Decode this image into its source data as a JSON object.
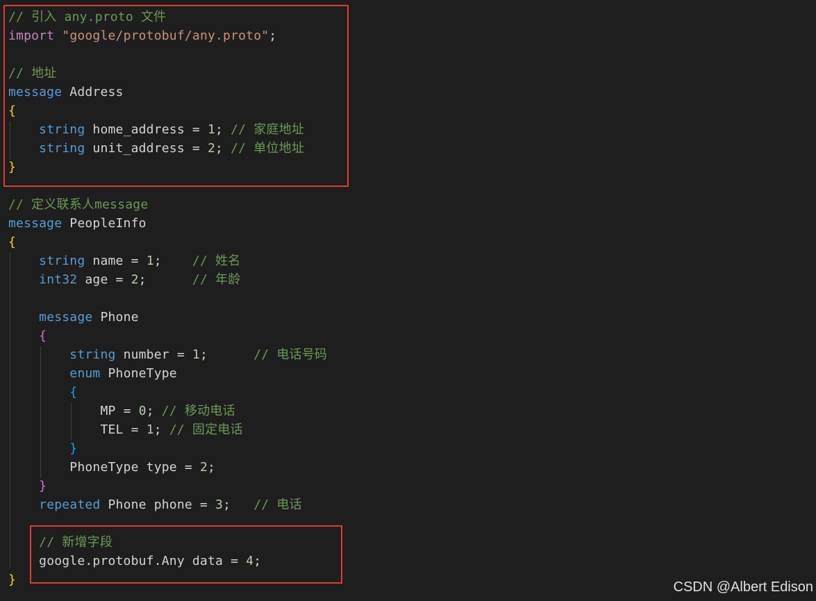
{
  "colors": {
    "background": "#1e1e1e",
    "comment": "#6a9955",
    "keyword": "#569cd6",
    "import_keyword": "#c586c0",
    "string": "#ce9178",
    "number": "#b5cea8",
    "identifier": "#d4d4d4",
    "brace_level1": "#ffd700",
    "brace_level2": "#da70d6",
    "brace_level3": "#179fff",
    "highlight_box": "#e53935"
  },
  "code": {
    "l1": {
      "comment": "// 引入 any.proto 文件"
    },
    "l2": {
      "kw": "import",
      "sp": " ",
      "str": "\"google/protobuf/any.proto\"",
      "punct": ";"
    },
    "l4": {
      "comment": "// 地址"
    },
    "l5": {
      "kw": "message",
      "name": " Address"
    },
    "l6": {
      "brace": "{"
    },
    "l7": {
      "indent": "    ",
      "type": "string",
      "field": " home_address = ",
      "num": "1",
      "semi": "; ",
      "comment": "// 家庭地址"
    },
    "l8": {
      "indent": "    ",
      "type": "string",
      "field": " unit_address = ",
      "num": "2",
      "semi": "; ",
      "comment": "// 单位地址"
    },
    "l9": {
      "brace": "}"
    },
    "l11": {
      "comment": "// 定义联系人message"
    },
    "l12": {
      "kw": "message",
      "name": " PeopleInfo"
    },
    "l13": {
      "brace": "{"
    },
    "l14": {
      "indent": "    ",
      "type": "string",
      "field": " name = ",
      "num": "1",
      "semi": ";    ",
      "comment": "// 姓名"
    },
    "l15": {
      "indent": "    ",
      "type": "int32",
      "field": " age = ",
      "num": "2",
      "semi": ";      ",
      "comment": "// 年龄"
    },
    "l17": {
      "indent": "    ",
      "kw": "message",
      "name": " Phone"
    },
    "l18": {
      "indent": "    ",
      "brace": "{"
    },
    "l19": {
      "indent": "        ",
      "type": "string",
      "field": " number = ",
      "num": "1",
      "semi": ";      ",
      "comment": "// 电话号码"
    },
    "l20": {
      "indent": "        ",
      "kw": "enum",
      "name": " PhoneType"
    },
    "l21": {
      "indent": "        ",
      "brace": "{"
    },
    "l22": {
      "indent": "            ",
      "field": "MP = ",
      "num": "0",
      "semi": "; ",
      "comment": "// 移动电话"
    },
    "l23": {
      "indent": "            ",
      "field": "TEL = ",
      "num": "1",
      "semi": "; ",
      "comment": "// 固定电话"
    },
    "l24": {
      "indent": "        ",
      "brace": "}"
    },
    "l25": {
      "indent": "        ",
      "field": "PhoneType type = ",
      "num": "2",
      "semi": ";"
    },
    "l26": {
      "indent": "    ",
      "brace": "}"
    },
    "l27": {
      "indent": "    ",
      "kw": "repeated",
      "field": " Phone phone = ",
      "num": "3",
      "semi": ";   ",
      "comment": "// 电话"
    },
    "l29": {
      "indent": "    ",
      "comment": "// 新增字段"
    },
    "l30": {
      "indent": "    ",
      "field": "google.protobuf.Any data = ",
      "num": "4",
      "semi": ";"
    },
    "l31": {
      "brace": "}"
    }
  },
  "watermark": "CSDN @Albert Edison"
}
